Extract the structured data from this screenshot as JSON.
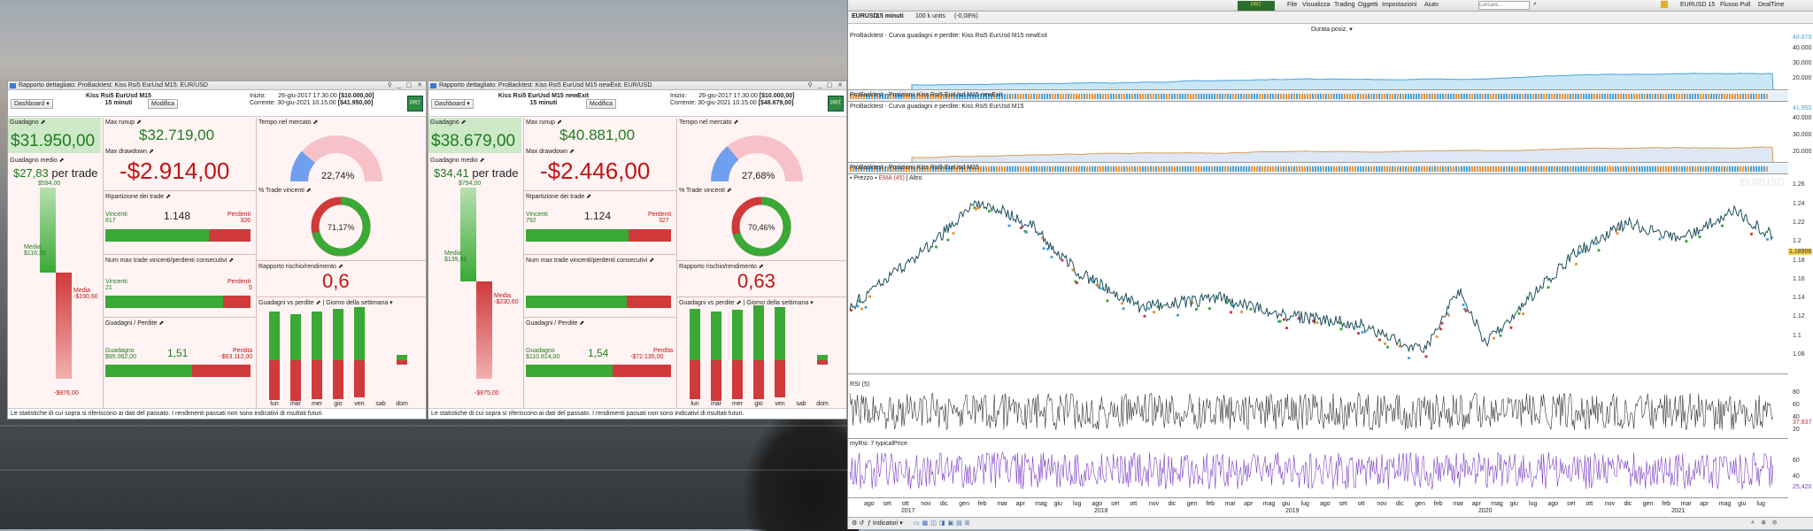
{
  "report1": {
    "title": "Rapporto dettagliato: ProBacktest: Kiss Rsi5 EurUsd M15: EUR/USD",
    "dashboard": "Dashboard",
    "strategy": "Kiss Rsi5 EurUsd M15",
    "timeframe": "15 minuti",
    "modify": "Modifica",
    "start_label": "Inizio:",
    "start": "26-giu-2017 17.30.00",
    "start_capital": "[$10.000,00]",
    "current_label": "Corrente:",
    "current": "30-giu-2021 10.15.00",
    "current_capital": "[$41.950,00]",
    "gain_label": "Guadagno",
    "gain": "$31.950,00",
    "avg_gain_label": "Guadagno medio",
    "avg_gain": "$27,83",
    "per_trade": "per trade",
    "v1": "$594,00",
    "media_label": "Media",
    "media_pos": "$116,35",
    "media_neg": "-$190,60",
    "v2": "-$876,00",
    "max_runup_label": "Max runup",
    "max_runup": "$32.719,00",
    "max_drawdown_label": "Max drawdown",
    "max_drawdown": "-$2.914,00",
    "distribution_label": "Ripartizione dei trade",
    "winners_label": "Vincenti",
    "winners": "817",
    "ratio1": "1.148",
    "losers_label": "Perdenti",
    "losers": "326",
    "consecutive_label": "Num max trade vincenti/perdenti consecutivi",
    "win_cons_label": "Vincenti",
    "win_cons": "21",
    "loss_cons_label": "Perdenti",
    "loss_cons": "5",
    "gl_label": "Guadagni / Perdite",
    "profit_label": "Guadagno",
    "profit": "$95.062,00",
    "pf": "1,51",
    "loss_label": "Perdita",
    "loss": "-$63.112,00",
    "time_label": "Tempo nel mercato",
    "time": "22,74%",
    "time_frac": 0.2274,
    "pct_win_label": "% Trade vincenti",
    "pct_win": "71,17%",
    "pct_win_frac": 0.7117,
    "rr_label": "Rapporto rischio/rendimento",
    "rr": "0,6",
    "gvp_label": "Guadagni vs perdite",
    "weekday_label": "Giorno della settimana",
    "footer": "Le statistiche di cui sopra si riferiscono ai dati del passato. I rendimenti passati non sono indicativi di risultati futuri."
  },
  "report2": {
    "title": "Rapporto dettagliato: ProBacktest: Kiss Rsi5 EurUsd M15 newExit: EUR/USD",
    "dashboard": "Dashboard",
    "strategy": "Kiss Rsi5 EurUsd M15 newExit",
    "timeframe": "15 minuti",
    "modify": "Modifica",
    "start_label": "Inizio:",
    "start": "26-giu-2017 17.30.00",
    "start_capital": "[$10.000,00]",
    "current_label": "Corrente:",
    "current": "30-giu-2021 10.15.00",
    "current_capital": "[$48.679,00]",
    "gain_label": "Guadagno",
    "gain": "$38.679,00",
    "avg_gain_label": "Guadagno medio",
    "avg_gain": "$34,41",
    "per_trade": "per trade",
    "v1": "$794,00",
    "media_label": "Media",
    "media_pos": "$139,92",
    "media_neg": "-$230,60",
    "v2": "-$875,00",
    "max_runup_label": "Max runup",
    "max_runup": "$40.881,00",
    "max_drawdown_label": "Max drawdown",
    "max_drawdown": "-$2.446,00",
    "distribution_label": "Ripartizione dei trade",
    "winners_label": "Vincenti",
    "winners": "792",
    "ratio1": "1.124",
    "losers_label": "Perdenti",
    "losers": "327",
    "consecutive_label": "Num max trade vincenti/perdenti consecutivi",
    "win_cons_label": "Vincenti",
    "win_cons": "",
    "loss_cons_label": "Perdenti",
    "loss_cons": "",
    "gl_label": "Guadagni / Perdite",
    "profit_label": "Guadagno",
    "profit": "$110.814,00",
    "pf": "1,54",
    "loss_label": "Perdita",
    "loss": "-$72.135,00",
    "time_label": "Tempo nel mercato",
    "time": "27,68%",
    "time_frac": 0.2768,
    "pct_win_label": "% Trade vincenti",
    "pct_win": "70,46%",
    "pct_win_frac": 0.7046,
    "rr_label": "Rapporto rischio/rendimento",
    "rr": "0,63",
    "gvp_label": "Guadagni vs perdite",
    "weekday_label": "Giorno della settimana",
    "footer": "Le statistiche di cui sopra si riferiscono ai dati del passato. I rendimenti passati non sono indicativi di risultati futuri."
  },
  "days": [
    "lun",
    "mar",
    "mer",
    "gio",
    "ven",
    "sab",
    "dom"
  ],
  "day_bars1": [
    {
      "g": 0.55,
      "r": 0.45
    },
    {
      "g": 0.52,
      "r": 0.46
    },
    {
      "g": 0.55,
      "r": 0.44
    },
    {
      "g": 0.58,
      "r": 0.44
    },
    {
      "g": 0.6,
      "r": 0.42
    },
    {
      "g": 0,
      "r": 0
    },
    {
      "g": 0.06,
      "r": 0.05
    }
  ],
  "day_bars2": [
    {
      "g": 0.58,
      "r": 0.44
    },
    {
      "g": 0.55,
      "r": 0.46
    },
    {
      "g": 0.57,
      "r": 0.44
    },
    {
      "g": 0.62,
      "r": 0.44
    },
    {
      "g": 0.6,
      "r": 0.42
    },
    {
      "g": 0,
      "r": 0
    },
    {
      "g": 0.06,
      "r": 0.05
    }
  ],
  "platform": {
    "menu": [
      "File",
      "Visualizza",
      "Trading",
      "Oggetti",
      "Impostazioni",
      "Aiuto"
    ],
    "search_placeholder": "Cercare...",
    "right_items": [
      "EURUSD 15",
      "Flusso Pull",
      "DealTime"
    ],
    "symbol": "EURUSD",
    "timeframe": "15 minuti",
    "units": "100 k units",
    "change": "(-0,08%)",
    "duration": "Durata posiz.",
    "p1": "ProBacktest - Curva guadagni e perdite: Kiss Rsi5 EurUsd M15 newExit",
    "p1_val": "48.679",
    "p2": "ProBacktest - Posizioni: Kiss Rsi5 EurUsd M15 newExit",
    "p3": "ProBacktest - Curva guadagni e perdite: Kiss Rsi5 EurUsd M15",
    "p3_val": "41.950",
    "p4": "ProBacktest - Posizioni: Kiss Rsi5 EurUsd M15",
    "prezzo": "Prezzo",
    "ema": "EMA (45)",
    "altro": "Altro",
    "watermark": "EURUSD",
    "price_now": "1,18906",
    "rsi": "RSI (5)",
    "rsi_val": "37,837",
    "myrsi": "myRsi: 7 typicalPrice",
    "myrsi_val": "25,420",
    "indicators": "Indicatori",
    "eq_axis": [
      "40.000",
      "30.000",
      "20.000"
    ],
    "eq2_axis": [
      "40.000",
      "30.000",
      "20.000"
    ],
    "price_axis": [
      "1.26",
      "1.24",
      "1.22",
      "1.2",
      "1.18",
      "1.16",
      "1.14",
      "1.12",
      "1.1",
      "1.08"
    ],
    "rsi_axis": [
      "80",
      "60",
      "40",
      "20"
    ],
    "myrsi_axis": [
      "60",
      "40"
    ],
    "xaxis": [
      "ago",
      "set",
      "ott",
      "nov",
      "dic",
      "gen",
      "feb",
      "mar",
      "apr",
      "mag",
      "giu",
      "lug",
      "ago",
      "set",
      "ott",
      "nov",
      "dic",
      "gen",
      "feb",
      "mar",
      "apr",
      "mag",
      "giu",
      "lug",
      "ago",
      "set",
      "ott",
      "nov",
      "dic",
      "gen",
      "feb",
      "mar",
      "apr",
      "mag",
      "giu",
      "lug",
      "ago",
      "set",
      "ott",
      "nov",
      "dic",
      "gen",
      "feb",
      "mar",
      "apr",
      "mag",
      "giu",
      "lug"
    ],
    "years": [
      "2017",
      "2018",
      "2019",
      "2020",
      "2021"
    ]
  },
  "colors": {
    "green": "#3aa935",
    "red": "#d03a3a",
    "blue": "#5b8def",
    "pink_bg": "#fff3f3",
    "equity": "#4aa3d8",
    "price": "#1f4f5c",
    "rsi": "#333333",
    "myrsi": "#7d3fc4"
  }
}
